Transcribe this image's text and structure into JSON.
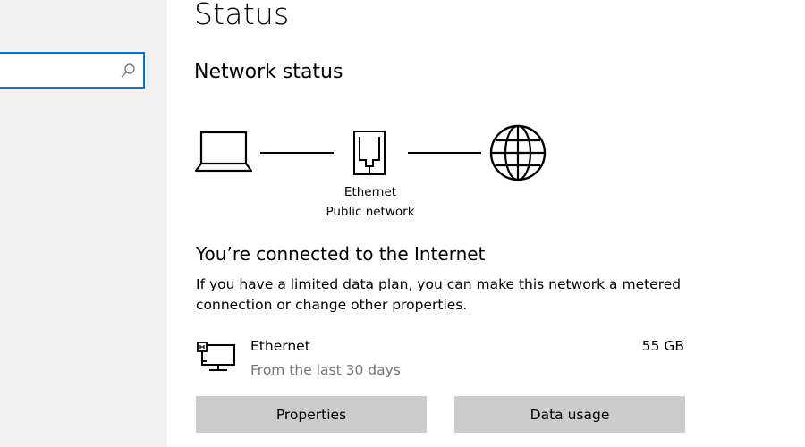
{
  "sidebar": {
    "search": {
      "value": "",
      "icon": "search-icon"
    }
  },
  "header": {
    "title": "Status"
  },
  "network_status": {
    "heading": "Network status",
    "diagram": {
      "icons": [
        "laptop-icon",
        "ethernet-icon",
        "globe-icon"
      ],
      "connection_name": "Ethernet",
      "network_type": "Public network"
    }
  },
  "connection": {
    "heading": "You’re connected to the Internet",
    "info": "If you have a limited data plan, you can make this network a metered connection or change other properties."
  },
  "adapter": {
    "icon": "network-adapter-icon",
    "name": "Ethernet",
    "subtitle": "From the last 30 days",
    "usage": "55 GB"
  },
  "buttons": {
    "properties": "Properties",
    "data_usage": "Data usage"
  },
  "colors": {
    "accent": "#0078d7",
    "sidebar_bg": "#f2f2f2",
    "button_bg": "#cccccc",
    "secondary_text": "#767676"
  }
}
